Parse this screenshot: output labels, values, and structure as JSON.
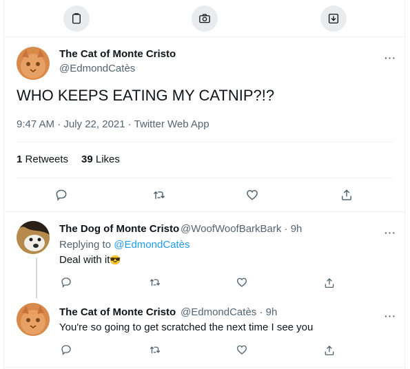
{
  "top_actions": {
    "icons": [
      "clipboard-icon",
      "camera-icon",
      "download-icon"
    ]
  },
  "main_tweet": {
    "display_name": "The Cat of Monte Cristo",
    "handle": "@EdmondCatès",
    "text": "WHO KEEPS EATING MY CATNIP?!?",
    "timestamp": "9:47 AM · July 22, 2021 · Twitter Web App",
    "retweets_count": "1",
    "retweets_label": "Retweets",
    "likes_count": "39",
    "likes_label": "Likes",
    "more": "···"
  },
  "replies": [
    {
      "display_name": "The Dog of Monte Cristo",
      "handle_time": "@WoofWoofBarkBark · 9h",
      "replying_to_label": "Replying to",
      "replying_to_handle": "@EdmondCatès",
      "text": "Deal with it",
      "emoji": "😎",
      "more": "···"
    },
    {
      "display_name": "The Cat of Monte Cristo",
      "handle_time": "@EdmondCatès · 9h",
      "text": "You're so going to get scratched the next time I see you",
      "more": "···"
    }
  ],
  "colors": {
    "text": "#0f1419",
    "muted": "#536471",
    "link": "#1d9bf0",
    "border": "#eff3f4",
    "icon_button_bg": "#e9ecee"
  }
}
